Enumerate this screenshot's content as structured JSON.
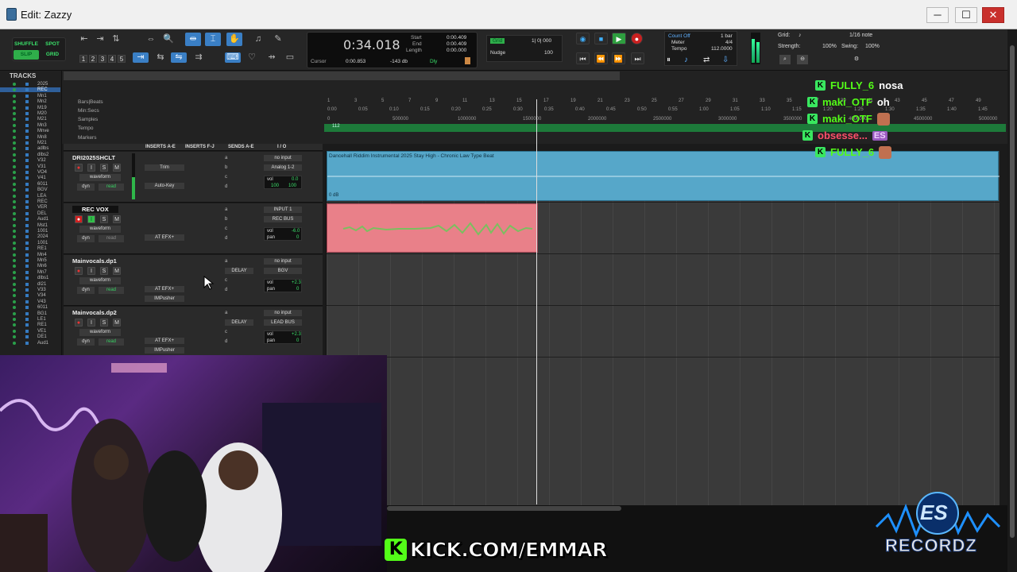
{
  "window": {
    "title": "Edit: Zazzy",
    "min": "─",
    "max": "☐",
    "close": "✕"
  },
  "toolbar": {
    "modes": {
      "shuffle": "SHUFFLE",
      "spot": "SPOT",
      "slip": "SLIP",
      "grid": "GRID"
    },
    "zoom_presets": [
      "1",
      "2",
      "3",
      "4",
      "5"
    ],
    "counter": {
      "main": "0:34.018",
      "start_label": "Start",
      "end_label": "End",
      "length_label": "Length",
      "start": "0:00.409",
      "end": "0:00.409",
      "length": "0:00.000",
      "cursor_label": "Cursor",
      "cursor": "0:00.853",
      "db": "-143 db",
      "dly": "Dly"
    },
    "grid_label": "Grid",
    "grid_value": "1| 0| 000",
    "nudge_label": "Nudge",
    "nudge_value": "100",
    "count_off": "Count Off",
    "meter_label": "Meter",
    "tempo_label": "Tempo",
    "count_bars": "1 bar",
    "meter": "4/4",
    "tempo": "112.0000",
    "grid_setting_label": "Grid:",
    "grid_setting": "1/16 note",
    "strength_label": "Strength:",
    "strength": "100%",
    "swing_label": "Swing:",
    "swing": "100%"
  },
  "tracks_panel": {
    "header": "TRACKS",
    "items": [
      "2025",
      "REC",
      "Mn1",
      "Mn2",
      "M19",
      "M20",
      "M21",
      "Mn3",
      "Mnve",
      "Mn8",
      "M21",
      "adlbs",
      "dlbs2",
      "V32",
      "V31",
      "VO4",
      "V41",
      "6011",
      "BGV",
      "LEA",
      "REC",
      "VER",
      "DEL",
      "Aud1",
      "Mst1",
      "1001",
      "2024",
      "1001",
      "RE1",
      "Mn4",
      "Mn5",
      "Mn6",
      "Mn7",
      "dlbs1",
      "dl21",
      "V33",
      "V34",
      "V43",
      "6011",
      "BG1",
      "LE1",
      "RE1",
      "VE1",
      "DE1",
      "Aud1"
    ]
  },
  "rulers": {
    "names": [
      "Bars|Beats",
      "Min:Secs",
      "Samples",
      "Tempo",
      "Markers"
    ],
    "bars": [
      "1",
      "3",
      "5",
      "7",
      "9",
      "11",
      "13",
      "15",
      "17",
      "19",
      "21",
      "23",
      "25",
      "27",
      "29",
      "31",
      "33",
      "35",
      "37",
      "39",
      "41",
      "43",
      "45",
      "47",
      "49",
      "51"
    ],
    "secs": [
      "0:00",
      "0:05",
      "0:10",
      "0:15",
      "0:20",
      "0:25",
      "0:30",
      "0:35",
      "0:40",
      "0:45",
      "0:50",
      "0:55",
      "1:00",
      "1:05",
      "1:10",
      "1:15",
      "1:20",
      "1:25",
      "1:30",
      "1:35",
      "1:40",
      "1:45"
    ],
    "samples": [
      "0",
      "500000",
      "1000000",
      "1500000",
      "2000000",
      "2500000",
      "3000000",
      "3500000",
      "4000000",
      "4500000",
      "5000000"
    ],
    "tempo_marker": "112"
  },
  "columns": {
    "inserts_ae": "INSERTS A-E",
    "inserts_fj": "INSERTS F-J",
    "sends_ae": "SENDS A-E",
    "io": "I / O"
  },
  "tracks": [
    {
      "name": "DRI2025SHCLT",
      "view": "waveform",
      "dyn": "dyn",
      "mode": "read",
      "inserts": [
        "Trim",
        "Auto-Key"
      ],
      "sends": [],
      "input": "no input",
      "output": "Analog 1-2",
      "vol": "0.0",
      "pan": "100",
      "pan2": "100",
      "vol_label": "vol"
    },
    {
      "name": "REC VOX",
      "view": "waveform",
      "dyn": "dyn",
      "mode": "read",
      "inserts": [
        "AT EFX+"
      ],
      "sends": [],
      "input": "INPUT 1",
      "output": "REC BUS",
      "vol": "-6.0",
      "pan": "0",
      "vol_label": "vol",
      "pan_label": "pan"
    },
    {
      "name": "Mainvocals.dp1",
      "view": "waveform",
      "dyn": "dyn",
      "mode": "read",
      "inserts": [
        "AT EFX+",
        "IMPusher"
      ],
      "sends": [
        "DELAY"
      ],
      "input": "no input",
      "output": "BGV",
      "vol": "+2.3",
      "pan": "0",
      "vol_label": "vol",
      "pan_label": "pan"
    },
    {
      "name": "Mainvocals.dp2",
      "view": "waveform",
      "dyn": "dyn",
      "mode": "read",
      "inserts": [
        "AT EFX+",
        "IMPusher"
      ],
      "sends": [
        "DELAY"
      ],
      "input": "no input",
      "output": "LEAD BUS",
      "vol": "+2.3",
      "pan": "0",
      "vol_label": "vol",
      "pan_label": "pan"
    }
  ],
  "clips": {
    "beat_name": "Dancehall Riddim Instrumental 2025 Stay High - Chronic Law Type Beat",
    "beat_gain": "0 dB"
  },
  "chat": [
    {
      "user": "FULLY_6",
      "msg": "nosa",
      "color": "#53fc18"
    },
    {
      "user": "maki_OTF",
      "msg": "oh",
      "color": "#53fc18"
    },
    {
      "user": "maki_OTF",
      "msg": "",
      "color": "#53fc18",
      "emote": true
    },
    {
      "user": "obsesse...",
      "msg": "ES",
      "color": "#ff4f6a",
      "emote_text": true
    },
    {
      "user": "FULLY_6",
      "msg": "",
      "color": "#53fc18",
      "emote": true
    }
  ],
  "overlay": {
    "kick": "KICK.COM/EMMAR",
    "logo_line1": "ES",
    "logo_line2": "RECORDZ"
  },
  "colors": {
    "accent_green": "#53fc18",
    "beat_clip": "#56a7c9",
    "vox_clip": "#e98089"
  }
}
